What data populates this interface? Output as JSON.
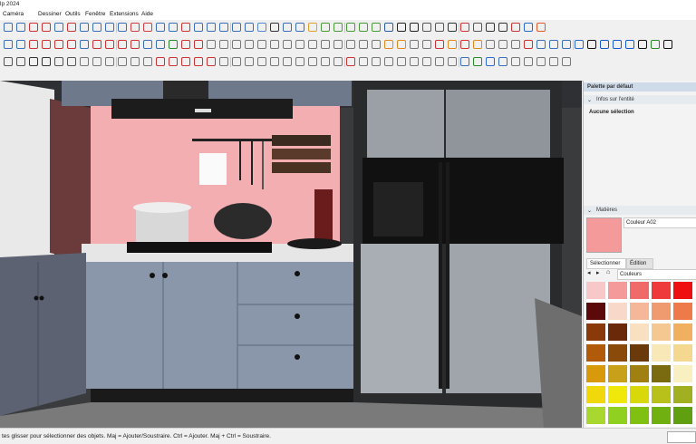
{
  "window": {
    "title": "lp 2024"
  },
  "menu": [
    "Caméra",
    "Dessiner",
    "Outils",
    "Fenêtre",
    "Extensions",
    "Aide"
  ],
  "toolbar": {
    "row1": [
      "#3b6fb6",
      "#3b6fb6",
      "#c33",
      "#c33",
      "#3b6fb6",
      "#c33",
      "#3b6fb6",
      "#3b6fb6",
      "#3b6fb6",
      "#3b6fb6",
      "#d04040",
      "#d04040",
      "#3b6fb6",
      "#3b6fb6",
      "#c33",
      "#3b6fb6",
      "#3b6fb6",
      "#3b6fb6",
      "#3b6fb6",
      "#3b6fb6",
      "#5588cc",
      "#333",
      "#3b6fb6",
      "#3b6fb6",
      "#e0a030",
      "#4a9a3a",
      "#4a9a3a",
      "#4a9a3a",
      "#4a9a3a",
      "#4a9a3a",
      "#2b5aa0",
      "#222",
      "#222",
      "#555",
      "#555",
      "#333",
      "#c33",
      "#555",
      "#333",
      "#333",
      "#c33",
      "#2a6ad0",
      "#e05a2a"
    ],
    "row2": [
      "#3b6fb6",
      "#3b6fb6",
      "#c33",
      "#c33",
      "#c33",
      "#c33",
      "#3b6fb6",
      "#c33",
      "#c33",
      "#c33",
      "#c33",
      "#3b6fb6",
      "#3b6fb6",
      "#2a8a2a",
      "#c33",
      "#c33",
      "#777",
      "#777",
      "#777",
      "#777",
      "#777",
      "#777",
      "#777",
      "#777",
      "#777",
      "#777",
      "#777",
      "#777",
      "#777",
      "#777",
      "#e08a20",
      "#e08a20",
      "#777",
      "#777",
      "#c33",
      "#e08a20",
      "#c33",
      "#e08a20",
      "#777",
      "#777",
      "#777",
      "#c33",
      "#3b6fb6",
      "#3b6fb6",
      "#3b6fb6",
      "#2a6ad0",
      "#111",
      "#1a5ad0",
      "#1a5ad0",
      "#1a5ad0",
      "#111",
      "#2a8a2a",
      "#111"
    ],
    "row3": [
      "#555",
      "#555",
      "#333",
      "#333",
      "#555",
      "#555",
      "#777",
      "#777",
      "#777",
      "#777",
      "#777",
      "#777",
      "#c33",
      "#c33",
      "#c33",
      "#c33",
      "#c33",
      "#777",
      "#777",
      "#777",
      "#777",
      "#777",
      "#777",
      "#777",
      "#777",
      "#777",
      "#777",
      "#c33",
      "#777",
      "#777",
      "#777",
      "#777",
      "#777",
      "#777",
      "#777",
      "#777",
      "#3b6fb6",
      "#2a8a2a",
      "#2a6ad0",
      "#3b6fb6",
      "#777",
      "#777",
      "#777",
      "#777",
      "#777"
    ]
  },
  "viewport": {
    "name": "kitchen-3d-model"
  },
  "panel": {
    "title": "Palette par défaut",
    "entity_info": {
      "header": "Infos sur l'entité",
      "selection": "Aucune sélection"
    },
    "materials": {
      "header": "Matières",
      "current_name": "Couleur A02",
      "current_color": "#f49a9a",
      "tabs": [
        "Sélectionner",
        "Édition"
      ],
      "library": "Couleurs",
      "swatches": [
        [
          "#f8c8c8",
          "#f49a9a",
          "#f06a6a",
          "#ee3a3a",
          "#ee1010"
        ],
        [
          "#5a0a0a",
          "#f8d8c8",
          "#f4b898",
          "#f09a70",
          "#ee7a4a"
        ],
        [
          "#8a3a0a",
          "#6a2a0a",
          "#f8e0c0",
          "#f4c890",
          "#f0b060"
        ],
        [
          "#b05a0a",
          "#8a4a0a",
          "#6a3a0a",
          "#f8e8b8",
          "#f4d890"
        ],
        [
          "#d89a0a",
          "#c8a01a",
          "#a08010",
          "#7a6a10",
          "#f8f0c0"
        ],
        [
          "#f0d80a",
          "#f0e80a",
          "#d8d80a",
          "#b8c01a",
          "#a0b020"
        ],
        [
          "#a8d830",
          "#90d020",
          "#80c010",
          "#70b010",
          "#60a010"
        ]
      ]
    }
  },
  "status": {
    "text": "tes glisser pour sélectionner des objets. Maj = Ajouter/Soustraire. Ctrl = Ajouter. Maj + Ctrl = Soustraire."
  }
}
